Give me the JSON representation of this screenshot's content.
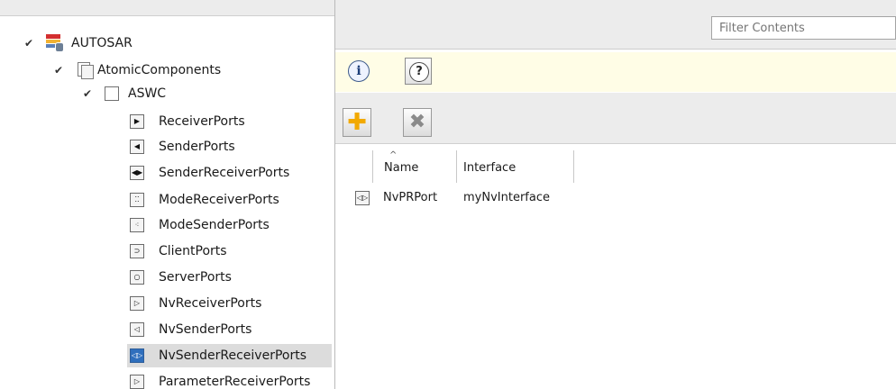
{
  "tree": {
    "root": {
      "label": "AUTOSAR",
      "icon": "autosar-icon"
    },
    "components": {
      "label": "AtomicComponents",
      "icon": "folder-icon"
    },
    "component": {
      "label": "ASWC",
      "icon": "component-icon"
    },
    "items": [
      {
        "label": "ReceiverPorts",
        "glyph": "▶",
        "icon": "receiver-port-icon"
      },
      {
        "label": "SenderPorts",
        "glyph": "◀",
        "icon": "sender-port-icon"
      },
      {
        "label": "SenderReceiverPorts",
        "glyph": "◀▶",
        "icon": "sender-receiver-port-icon"
      },
      {
        "label": "ModeReceiverPorts",
        "glyph": "⁚⁚",
        "icon": "mode-receiver-port-icon"
      },
      {
        "label": "ModeSenderPorts",
        "glyph": "⁖",
        "icon": "mode-sender-port-icon"
      },
      {
        "label": "ClientPorts",
        "glyph": "⊃",
        "icon": "client-port-icon"
      },
      {
        "label": "ServerPorts",
        "glyph": "○",
        "icon": "server-port-icon"
      },
      {
        "label": "NvReceiverPorts",
        "glyph": "▷",
        "icon": "nv-receiver-port-icon"
      },
      {
        "label": "NvSenderPorts",
        "glyph": "◁",
        "icon": "nv-sender-port-icon"
      },
      {
        "label": "NvSenderReceiverPorts",
        "glyph": "◁▷",
        "icon": "nv-sender-receiver-port-icon"
      },
      {
        "label": "ParameterReceiverPorts",
        "glyph": "▷",
        "icon": "parameter-receiver-port-icon"
      }
    ],
    "selected": "NvSenderReceiverPorts"
  },
  "filter": {
    "placeholder": "Filter Contents"
  },
  "infobar": {
    "info_icon": "info-icon",
    "help_icon": "help-icon",
    "help_glyph": "?",
    "info_glyph": "i"
  },
  "toolbar": {
    "add_icon": "add-icon",
    "add_glyph": "✚",
    "delete_icon": "delete-icon",
    "delete_glyph": "✖"
  },
  "table": {
    "columns": [
      "Name",
      "Interface"
    ],
    "sort_indicator": "^",
    "rows": [
      {
        "icon": "nv-sender-receiver-port-icon",
        "glyph": "◁▷",
        "name": "NvPRPort",
        "interface": "myNvInterface"
      }
    ]
  },
  "colors": {
    "infobar_bg": "#fffde6",
    "selection_bg": "#dcdcdc",
    "toolbar_bg": "#ececec",
    "add_accent": "#f2a900"
  }
}
